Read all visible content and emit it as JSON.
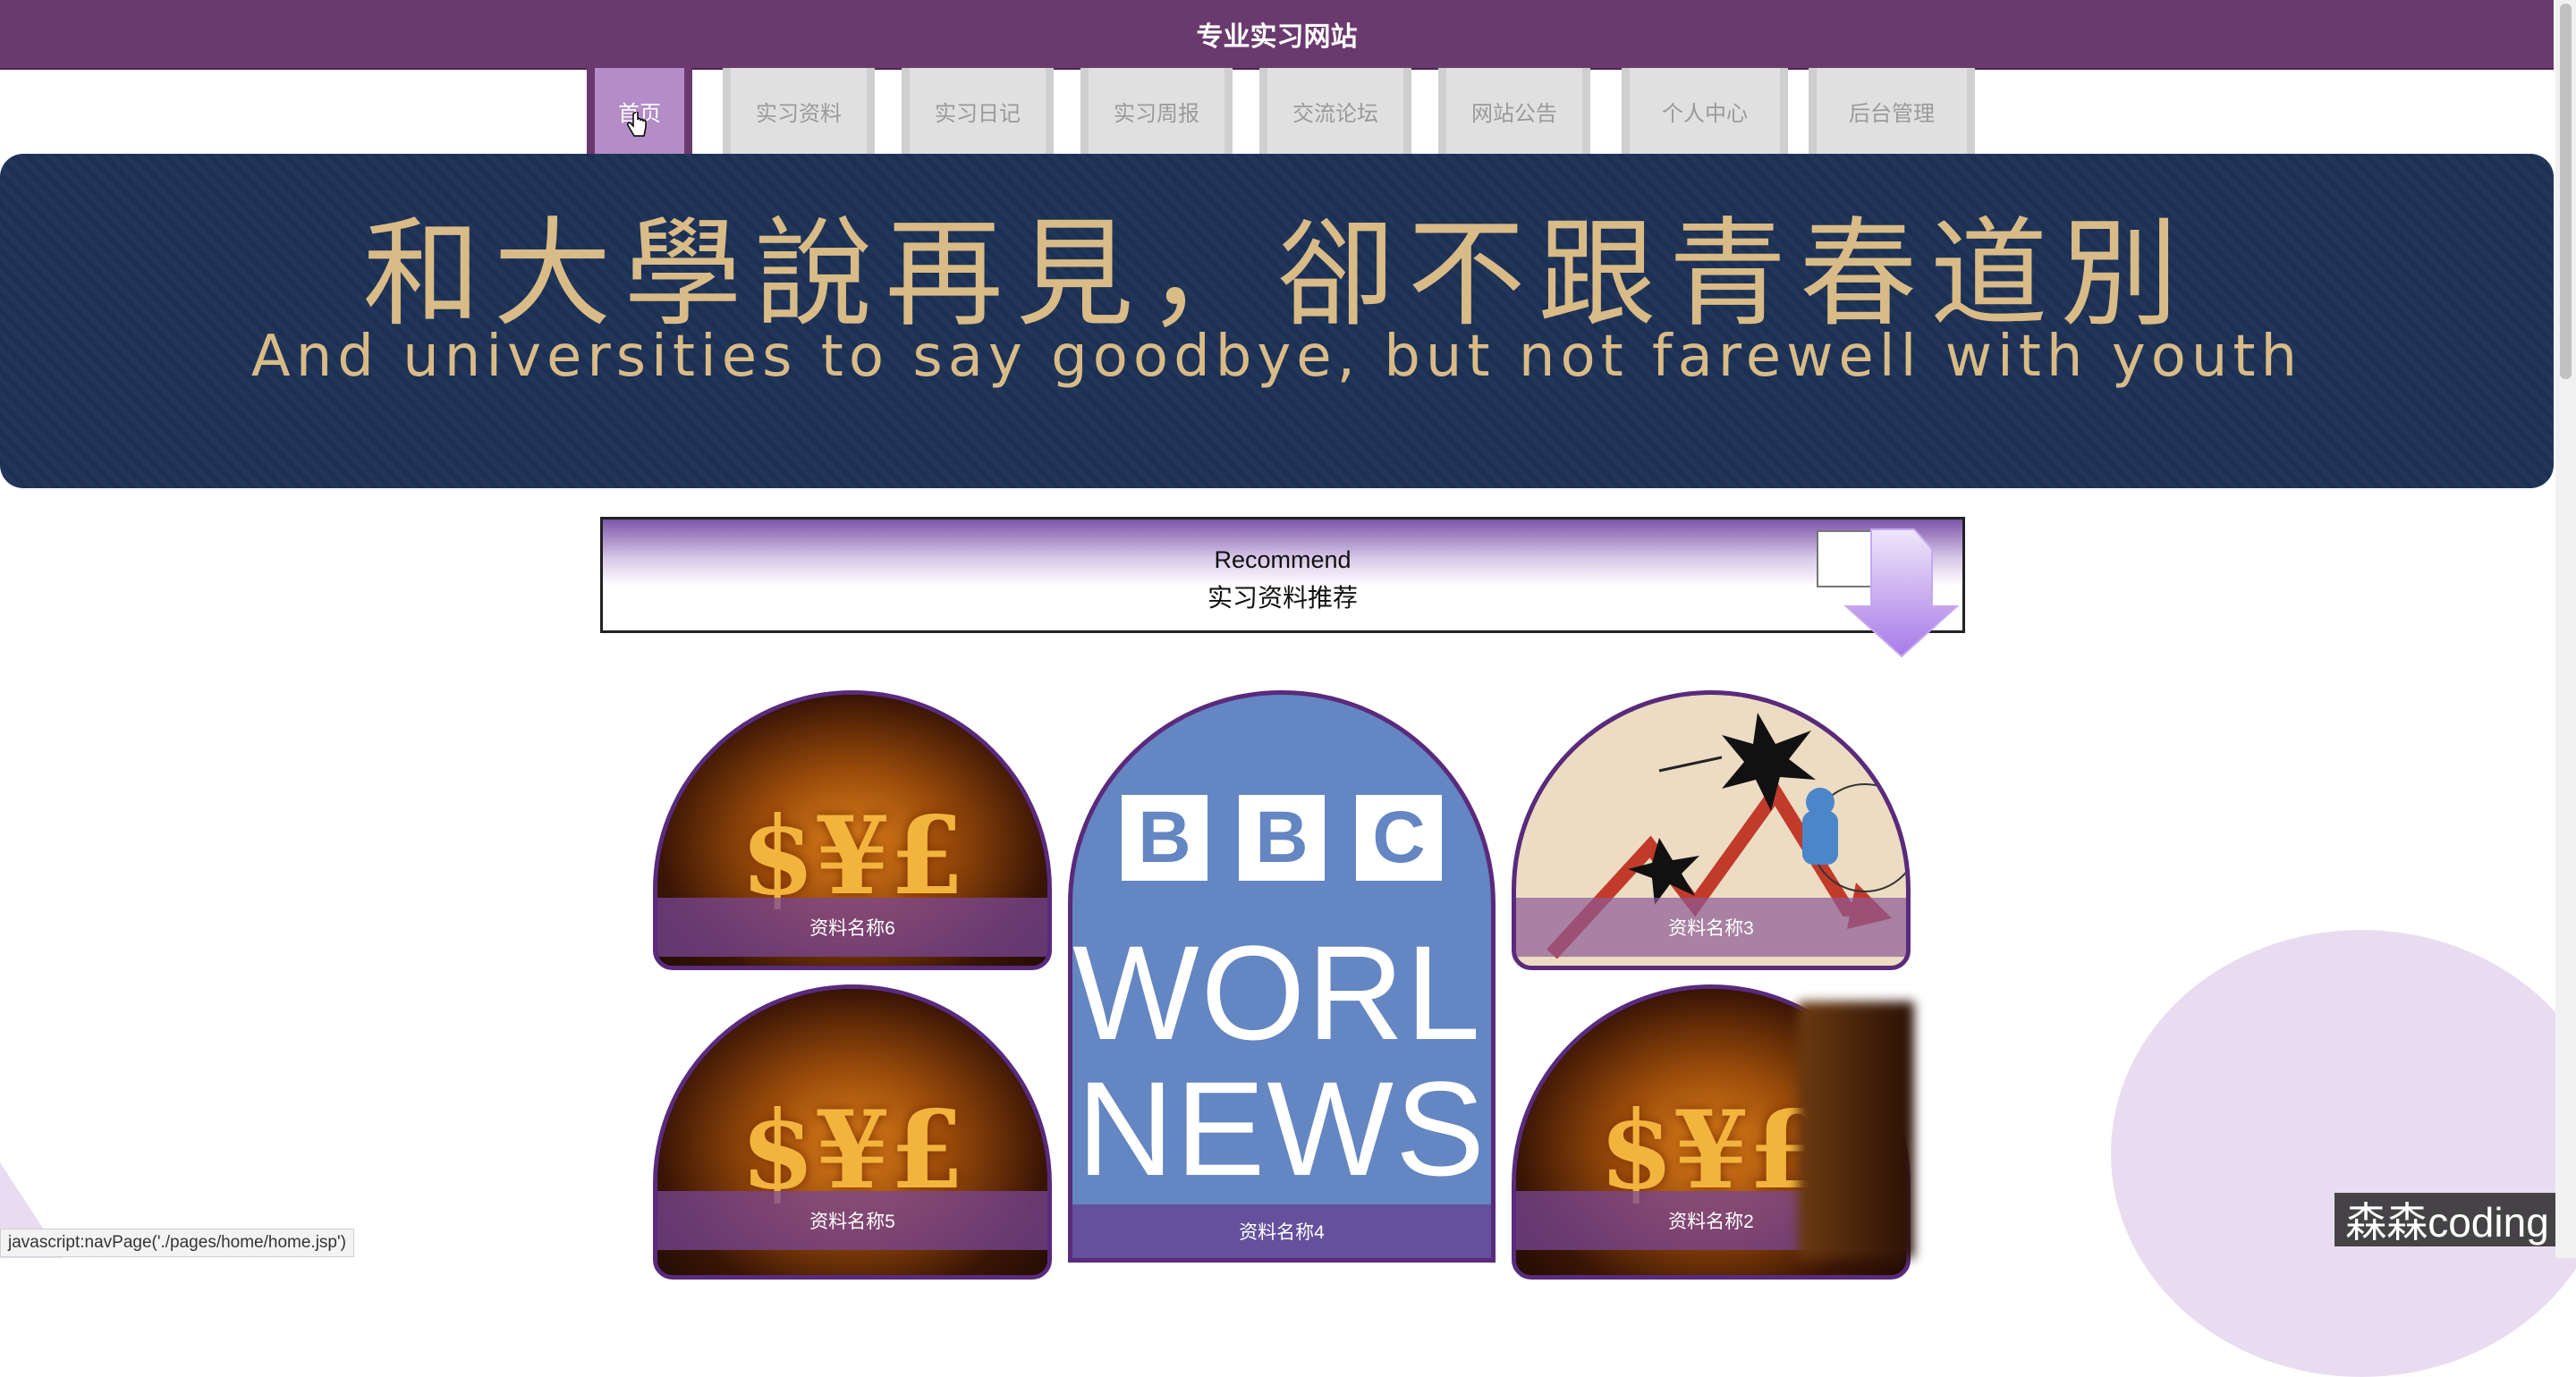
{
  "site": {
    "title": "专业实习网站"
  },
  "nav": {
    "items": [
      {
        "label": "首页",
        "active": true
      },
      {
        "label": "实习资料",
        "active": false
      },
      {
        "label": "实习日记",
        "active": false
      },
      {
        "label": "实习周报",
        "active": false
      },
      {
        "label": "交流论坛",
        "active": false
      },
      {
        "label": "网站公告",
        "active": false
      },
      {
        "label": "个人中心",
        "active": false
      },
      {
        "label": "后台管理",
        "active": false
      }
    ]
  },
  "banner": {
    "cn": "和大學說再見，卻不跟青春道別",
    "en": "And universities to say goodbye, but not farewell with youth"
  },
  "recommend": {
    "en": "Recommend",
    "cn": "实习资料推荐"
  },
  "cards": {
    "c6": "资料名称6",
    "c4": "资料名称4",
    "c3": "资料名称3",
    "c5": "资料名称5",
    "c2": "资料名称2"
  },
  "bbc": {
    "letters": [
      "B",
      "B",
      "C"
    ],
    "line1": "WORLD",
    "line2": "NEWS"
  },
  "gold_symbols": "$¥£",
  "statusbar": {
    "text": "javascript:navPage('./pages/home/home.jsp')"
  },
  "watermark": {
    "text": "森森coding"
  },
  "colors": {
    "brand": "#6a3a6e",
    "accent": "#b48cc8",
    "banner_bg": "#1d3256",
    "banner_text": "#d9bb87"
  }
}
